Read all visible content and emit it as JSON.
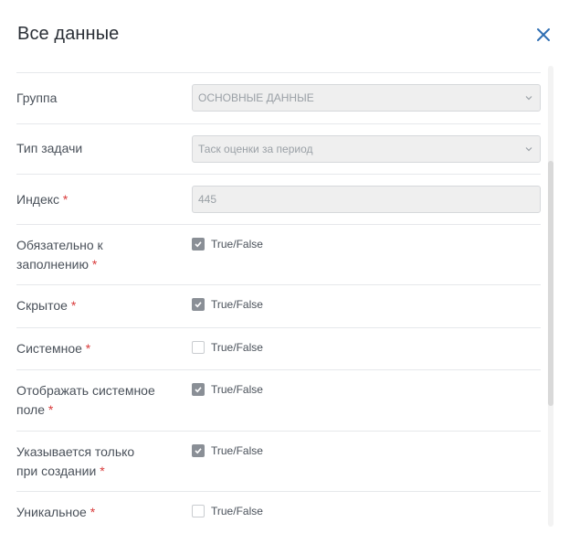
{
  "dialog": {
    "title": "Все данные"
  },
  "fields": {
    "group": {
      "label": "Группа",
      "value": "ОСНОВНЫЕ ДАННЫЕ"
    },
    "task_type": {
      "label": "Тип задачи",
      "value": "Таск оценки за период"
    },
    "index": {
      "label": "Индекс",
      "required": "*",
      "value": "445"
    },
    "mandatory": {
      "label_line1": "Обязательно к",
      "label_line2": "заполнению",
      "required": "*",
      "checked": true,
      "option": "True/False"
    },
    "hidden": {
      "label": "Скрытое",
      "required": "*",
      "checked": true,
      "option": "True/False"
    },
    "system": {
      "label": "Системное",
      "required": "*",
      "checked": false,
      "option": "True/False"
    },
    "show_system": {
      "label_line1": "Отображать системное",
      "label_line2": "поле",
      "required": "*",
      "checked": true,
      "option": "True/False"
    },
    "on_create": {
      "label_line1": "Указывается только",
      "label_line2": "при создании",
      "required": "*",
      "checked": true,
      "option": "True/False"
    },
    "unique": {
      "label": "Уникальное",
      "required": "*",
      "checked": false,
      "option": "True/False"
    }
  },
  "colors": {
    "close_icon": "#2f6fb3",
    "required": "#d93a3a"
  }
}
